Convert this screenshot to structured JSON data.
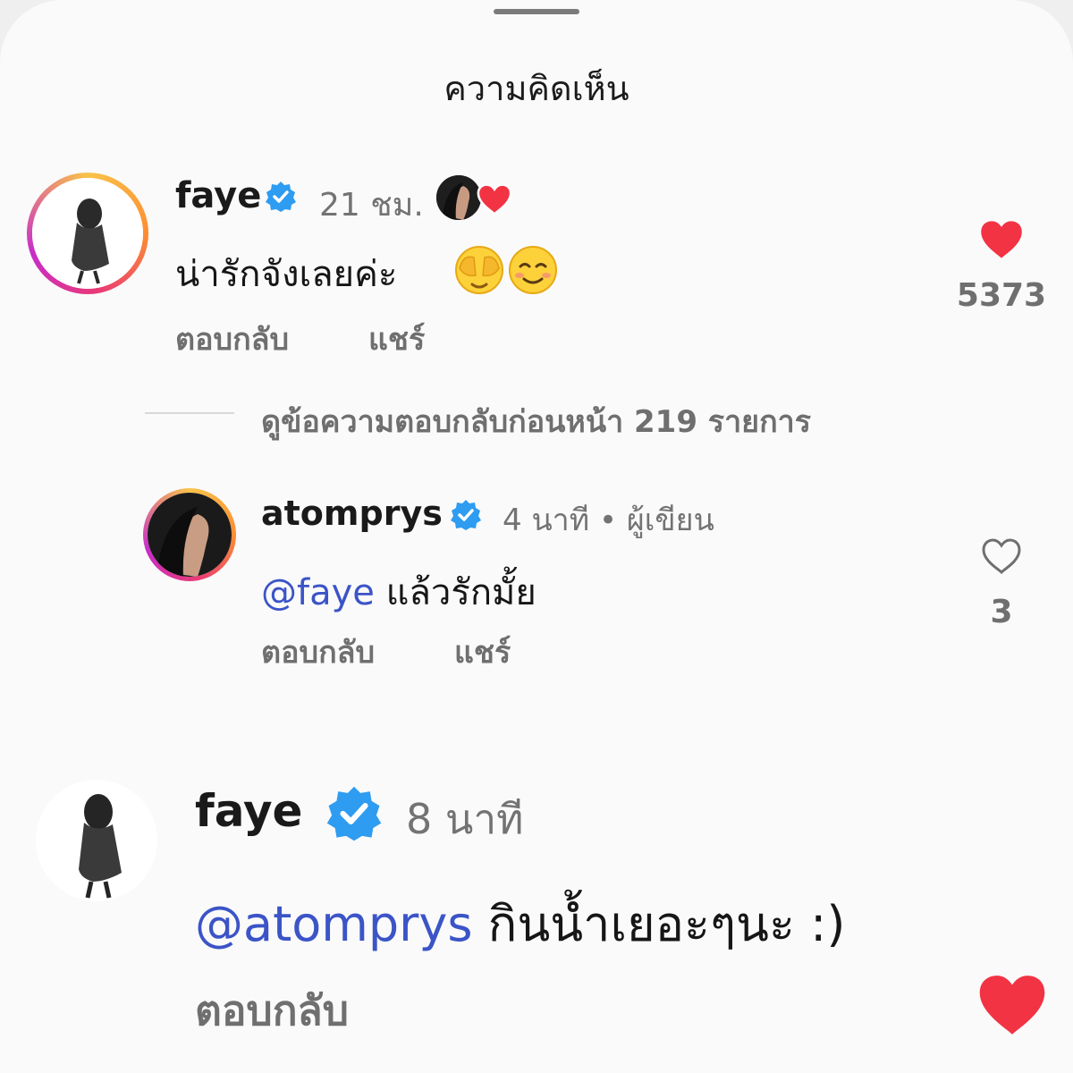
{
  "sheet": {
    "title": "ความคิดเห็น"
  },
  "comments": [
    {
      "username": "faye",
      "time": "21 ชม.",
      "text": "น่ารักจังเลยค่ะ",
      "emojis": [
        "face-with-hand-over-eyes-emoji",
        "smiling-face-emoji"
      ],
      "actions": [
        "ตอบกลับ",
        "แชร์"
      ],
      "likes": "5373",
      "liked": true
    },
    {
      "username": "atomprys",
      "time": "4 นาที",
      "separator": "•",
      "role": "ผู้เขียน",
      "mention": "@faye",
      "text": "แล้วรักมั้ย",
      "actions": [
        "ตอบกลับ",
        "แชร์"
      ],
      "likes": "3",
      "liked": false
    },
    {
      "username": "faye",
      "time": "8 นาที",
      "mention": "@atomprys",
      "text": "กินน้ำเยอะๆนะ :)",
      "actions": [
        "ตอบกลับ"
      ],
      "liked": true
    }
  ],
  "view_previous_replies": "ดูข้อความตอบกลับก่อนหน้า 219 รายการ",
  "colors": {
    "heart_red": "#f23343",
    "verified_blue": "#2e9cf1",
    "mention_blue": "#3b54c7",
    "muted_gray": "#737373"
  }
}
